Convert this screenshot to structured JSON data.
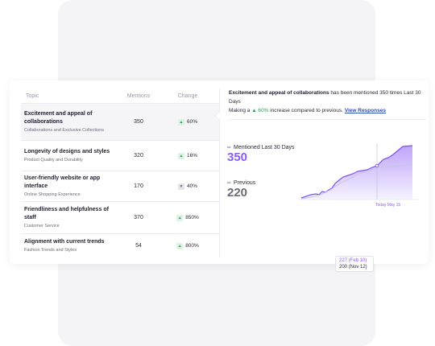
{
  "table": {
    "headers": {
      "topic": "Topic",
      "mentions": "Mentions",
      "change": "Change"
    },
    "rows": [
      {
        "title": "Excitement and appeal of collaborations",
        "subtitle": "Collaborations and Exclusive Collections",
        "mentions": "350",
        "change": "60%",
        "direction": "up",
        "selected": true
      },
      {
        "title": "Longevity of designs and styles",
        "subtitle": "Product Quality and Durability",
        "mentions": "320",
        "change": "16%",
        "direction": "up"
      },
      {
        "title": "User-friendly website or app interface",
        "subtitle": "Online Shopping Experience",
        "mentions": "170",
        "change": "40%",
        "direction": "down"
      },
      {
        "title": "Friendliness and helpfulness of staff",
        "subtitle": "Customer Service",
        "mentions": "370",
        "change": "850%",
        "direction": "up"
      },
      {
        "title": "Alignment with current trends",
        "subtitle": "Fashion Trends and Styles",
        "mentions": "54",
        "change": "800%",
        "direction": "up"
      }
    ]
  },
  "summary": {
    "topic": "Excitement and appeal of collaborations",
    "text1": " has been mentioned 350 times Last 30 Days",
    "text2": "Making a ",
    "pct": "▲ 60%",
    "text3": " increase compared to previous. ",
    "link": "View Responses"
  },
  "stats": {
    "current_label": "Mentioned Last 30 Days",
    "current_value": "350",
    "previous_label": "Previous",
    "previous_value": "220"
  },
  "tooltip": {
    "line1": "227 (Feb 10)",
    "line2": "200 (Nov 12)"
  },
  "today_label": "Today May 15",
  "icons": {
    "up": "▲",
    "down": "▼",
    "pencil": "pencil-icon"
  },
  "colors": {
    "accent": "#8b5cf6",
    "up": "#2f9e55",
    "link": "#2d4fb0"
  }
}
